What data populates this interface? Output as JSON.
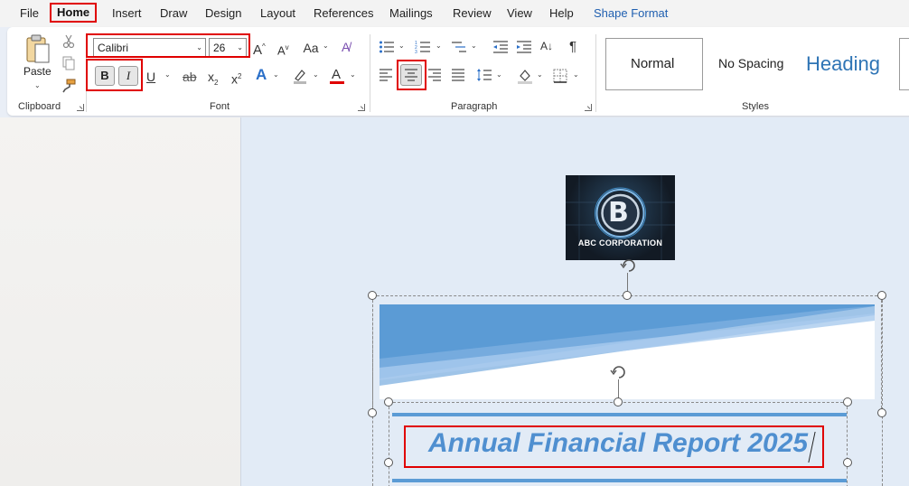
{
  "menu": {
    "file": "File",
    "home": "Home",
    "insert": "Insert",
    "draw": "Draw",
    "design": "Design",
    "layout": "Layout",
    "references": "References",
    "mailings": "Mailings",
    "review": "Review",
    "view": "View",
    "help": "Help",
    "shape_format": "Shape Format"
  },
  "clipboard": {
    "paste_label": "Paste",
    "group_label": "Clipboard"
  },
  "font": {
    "family_value": "Calibri",
    "size_value": "26",
    "bold_label": "B",
    "italic_label": "I",
    "underline_label": "U",
    "strike_label": "ab",
    "case_label": "Aa",
    "group_label": "Font",
    "font_color": "#e00000"
  },
  "paragraph": {
    "group_label": "Paragraph"
  },
  "styles": {
    "normal": "Normal",
    "no_spacing": "No Spacing",
    "heading": "Heading",
    "group_label": "Styles"
  },
  "document": {
    "logo_text": "ABC CORPORATION",
    "logo_letter": "B",
    "title": "Annual Financial Report 2025"
  },
  "colors": {
    "highlight_box": "#e00000",
    "accent": "#1f5fb0",
    "title_blue": "#4f8fd0"
  }
}
